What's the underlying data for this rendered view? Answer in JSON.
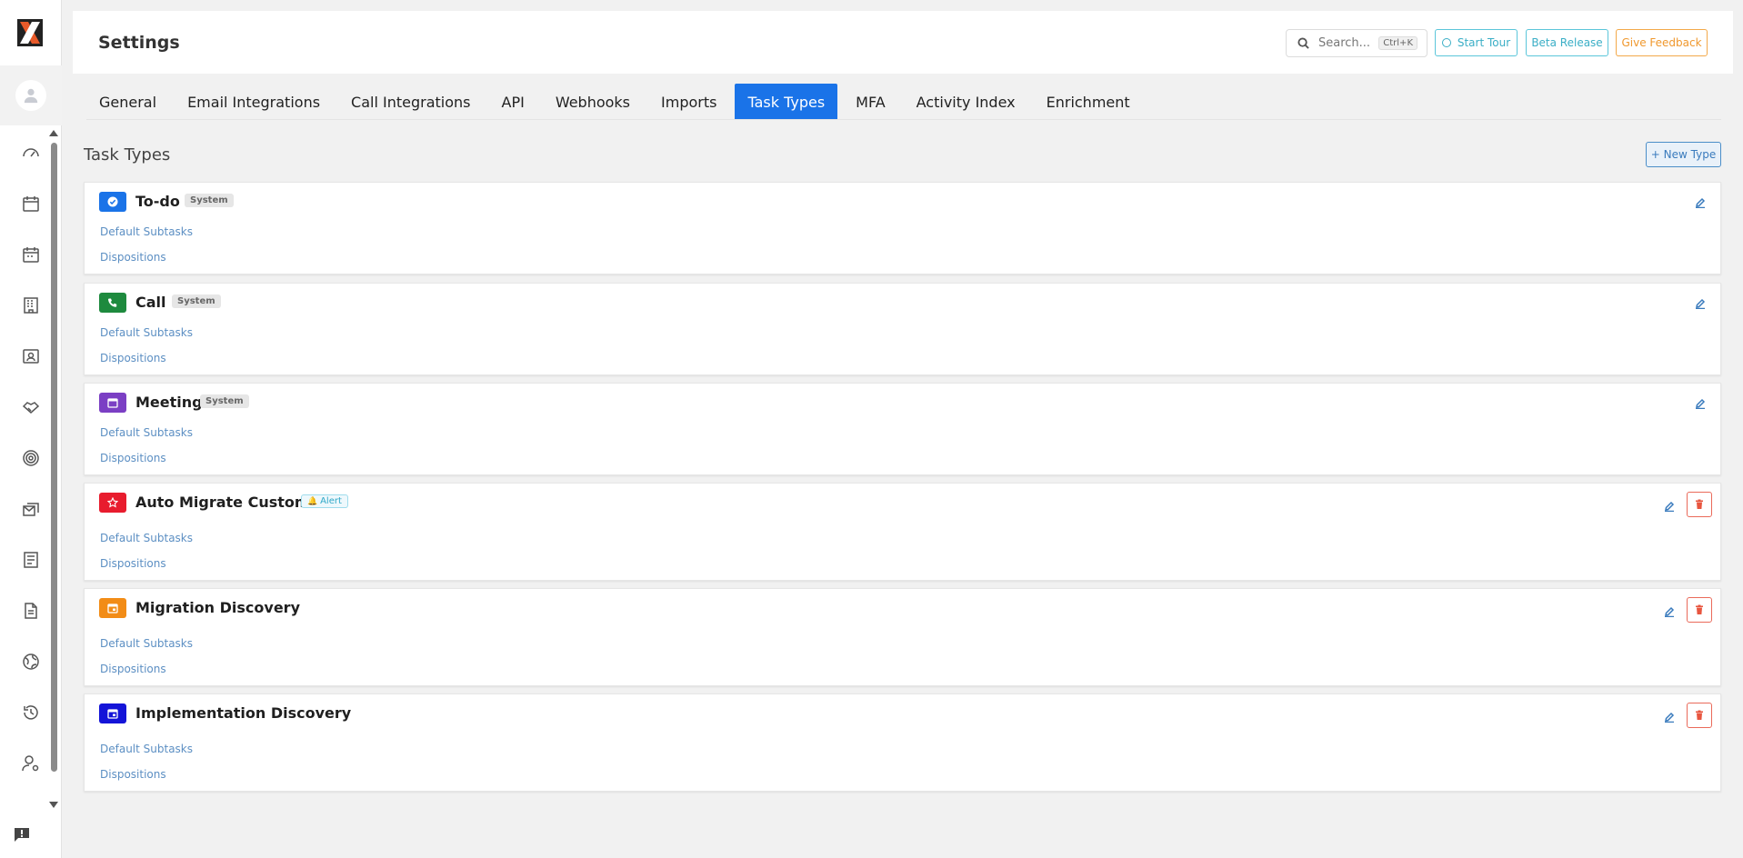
{
  "header": {
    "title": "Settings",
    "search_placeholder": "Search...",
    "search_shortcut": "Ctrl+K",
    "start_tour": "Start Tour",
    "beta_release": "Beta Release",
    "give_feedback": "Give Feedback"
  },
  "tabs": [
    {
      "label": "General"
    },
    {
      "label": "Email Integrations"
    },
    {
      "label": "Call Integrations"
    },
    {
      "label": "API"
    },
    {
      "label": "Webhooks"
    },
    {
      "label": "Imports"
    },
    {
      "label": "Task Types",
      "active": true
    },
    {
      "label": "MFA"
    },
    {
      "label": "Activity Index"
    },
    {
      "label": "Enrichment"
    }
  ],
  "section": {
    "title": "Task Types",
    "new_button": "+ New Type"
  },
  "task_types": [
    {
      "name": "To-do",
      "badge": "System",
      "color": "#1a73e8",
      "icon": "check-circle-icon",
      "subtasks": "Default Subtasks",
      "dispositions": "Dispositions"
    },
    {
      "name": "Call",
      "badge": "System",
      "color": "#1e8a3e",
      "icon": "phone-icon",
      "subtasks": "Default Subtasks",
      "dispositions": "Dispositions"
    },
    {
      "name": "Meeting",
      "badge": "System",
      "color": "#7b3fc4",
      "icon": "calendar-icon",
      "subtasks": "Default Subtasks",
      "dispositions": "Dispositions"
    },
    {
      "name": "Auto Migrate Customer",
      "badge": "Alert",
      "color": "#e81c2e",
      "icon": "star-icon",
      "subtasks": "Default Subtasks",
      "dispositions": "Dispositions"
    },
    {
      "name": "Migration Discovery",
      "badge": "",
      "color": "#f28c16",
      "icon": "calendar-event-icon",
      "subtasks": "Default Subtasks",
      "dispositions": "Dispositions"
    },
    {
      "name": "Implementation Discovery",
      "badge": "",
      "color": "#1414d8",
      "icon": "calendar-event-icon",
      "subtasks": "Default Subtasks",
      "dispositions": "Dispositions"
    }
  ],
  "colors": {
    "accent": "#1a73e8",
    "tour": "#3aaec6",
    "feedback": "#f0982d",
    "delete": "#e8553f"
  }
}
